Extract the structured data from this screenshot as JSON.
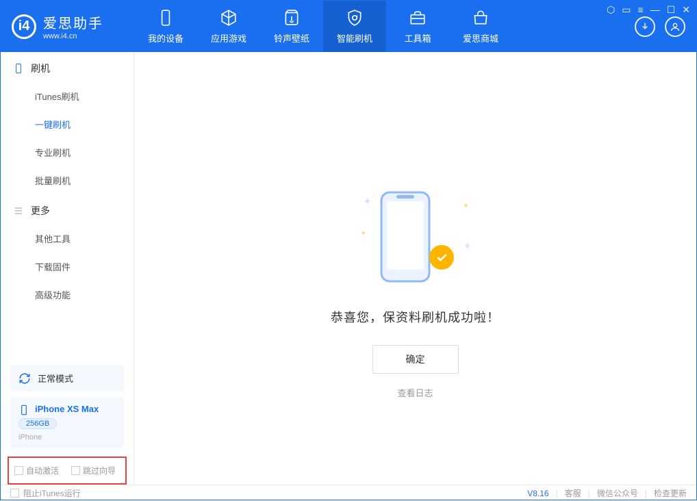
{
  "app": {
    "title": "爱思助手",
    "subtitle": "www.i4.cn"
  },
  "nav": {
    "tabs": [
      {
        "label": "我的设备"
      },
      {
        "label": "应用游戏"
      },
      {
        "label": "铃声壁纸"
      },
      {
        "label": "智能刷机"
      },
      {
        "label": "工具箱"
      },
      {
        "label": "爱思商城"
      }
    ]
  },
  "sidebar": {
    "section1_title": "刷机",
    "items1": [
      {
        "label": "iTunes刷机"
      },
      {
        "label": "一键刷机"
      },
      {
        "label": "专业刷机"
      },
      {
        "label": "批量刷机"
      }
    ],
    "section2_title": "更多",
    "items2": [
      {
        "label": "其他工具"
      },
      {
        "label": "下载固件"
      },
      {
        "label": "高级功能"
      }
    ]
  },
  "device": {
    "mode": "正常模式",
    "name": "iPhone XS Max",
    "capacity": "256GB",
    "type": "iPhone"
  },
  "options": {
    "auto_activate_label": "自动激活",
    "skip_guide_label": "跳过向导"
  },
  "main": {
    "success_text": "恭喜您，保资料刷机成功啦！",
    "ok_button": "确定",
    "log_link": "查看日志"
  },
  "footer": {
    "block_itunes": "阻止iTunes运行",
    "version": "V8.16",
    "links": [
      "客服",
      "微信公众号",
      "检查更新"
    ]
  }
}
